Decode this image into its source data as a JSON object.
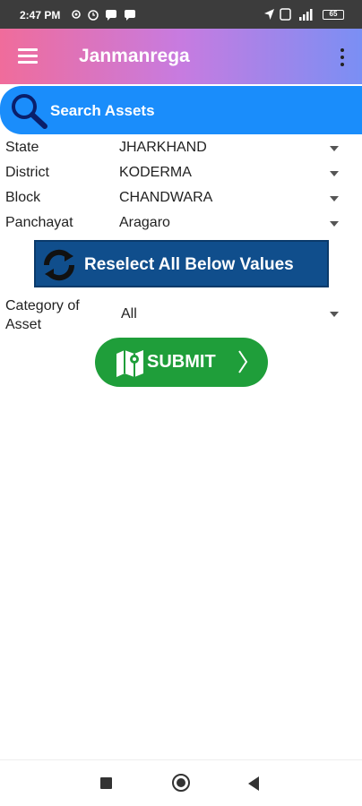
{
  "status_bar": {
    "time": "2:47 PM",
    "battery": "65"
  },
  "app_bar": {
    "title": "Janmanrega"
  },
  "search_banner": {
    "title": "Search Assets"
  },
  "form": {
    "fields": [
      {
        "label": "State",
        "value": "JHARKHAND"
      },
      {
        "label": "District",
        "value": "KODERMA"
      },
      {
        "label": "Block",
        "value": "CHANDWARA"
      },
      {
        "label": "Panchayat",
        "value": "Aragaro"
      }
    ],
    "reselect_label": "Reselect All Below Values",
    "category": {
      "label": "Category of Asset",
      "value": "All"
    },
    "submit_label": "SUBMIT"
  },
  "colors": {
    "app_bar_gradient": [
      "#f06c9b",
      "#c77be0",
      "#7a8ff4"
    ],
    "search_banner": "#1a8dfb",
    "reselect_button": "#104e8c",
    "submit_button": "#1f9e3a"
  },
  "icons": [
    "menu-icon",
    "more-vert-icon",
    "search-icon",
    "refresh-icon",
    "map-icon",
    "chevron-right-icon"
  ]
}
